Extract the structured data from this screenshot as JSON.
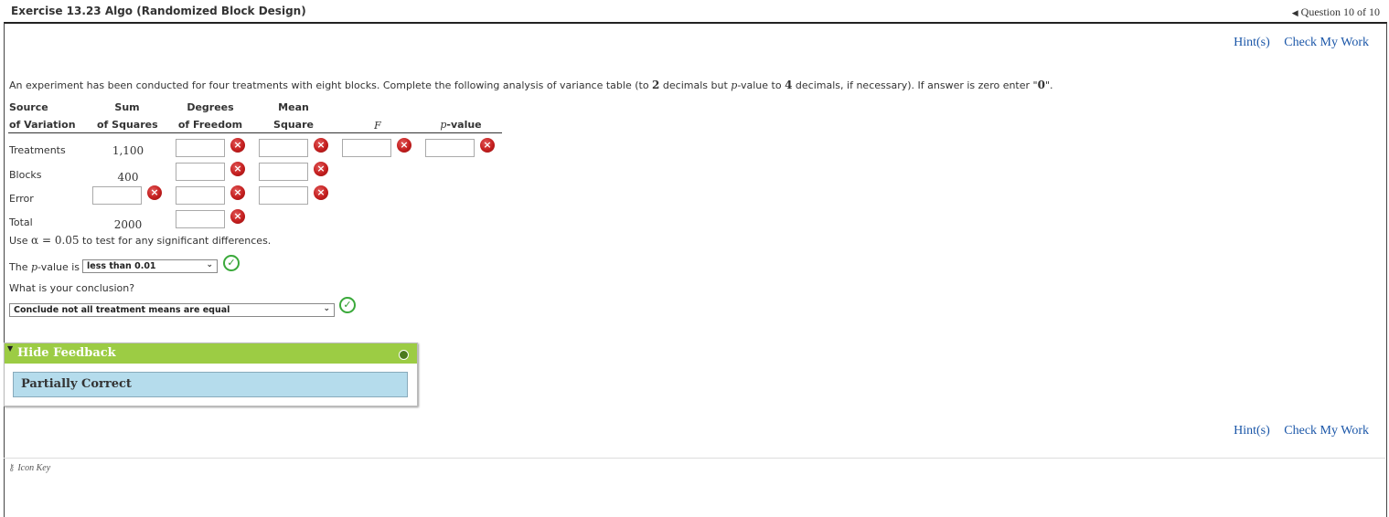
{
  "header": {
    "title": "Exercise 13.23 Algo (Randomized Block Design)",
    "question_nav": "Question 10 of 10"
  },
  "links": {
    "hints": "Hint(s)",
    "check": "Check My Work"
  },
  "instructions": {
    "part1": "An experiment has been conducted for four treatments with eight blocks. Complete the following analysis of variance table (to ",
    "two": "2",
    "part2": " decimals but ",
    "p": "p",
    "part3": "-value to ",
    "four": "4",
    "part4": " decimals, if necessary). If answer is zero enter \"",
    "zero": "0",
    "part5": "\"."
  },
  "table": {
    "headers": {
      "source1": "Source",
      "source2": "of Variation",
      "ss1": "Sum",
      "ss2": "of Squares",
      "df1": "Degrees",
      "df2": "of Freedom",
      "ms1": "Mean",
      "ms2": "Square",
      "f": "F",
      "p1": "p",
      "p2": "-value"
    },
    "rows": {
      "treatments": {
        "label": "Treatments",
        "ss": "1,100"
      },
      "blocks": {
        "label": "Blocks",
        "ss": "400"
      },
      "error": {
        "label": "Error"
      },
      "total": {
        "label": "Total",
        "ss": "2000"
      }
    }
  },
  "alpha_line": {
    "pre": "Use ",
    "alpha": "α = 0.05",
    "post": " to test for any significant differences."
  },
  "pvalue_q": {
    "pre": "The ",
    "p": "p",
    "post": "-value is",
    "selected": "less than 0.01"
  },
  "conclusion_q": {
    "label": "What is your conclusion?",
    "selected": "Conclude not all treatment means are equal"
  },
  "feedback": {
    "toggle": "Hide Feedback",
    "status": "Partially Correct"
  },
  "footer": {
    "icon_key": "Icon Key"
  },
  "icons": {
    "incorrect": "×",
    "correct": "✓",
    "caret": "⌄"
  }
}
